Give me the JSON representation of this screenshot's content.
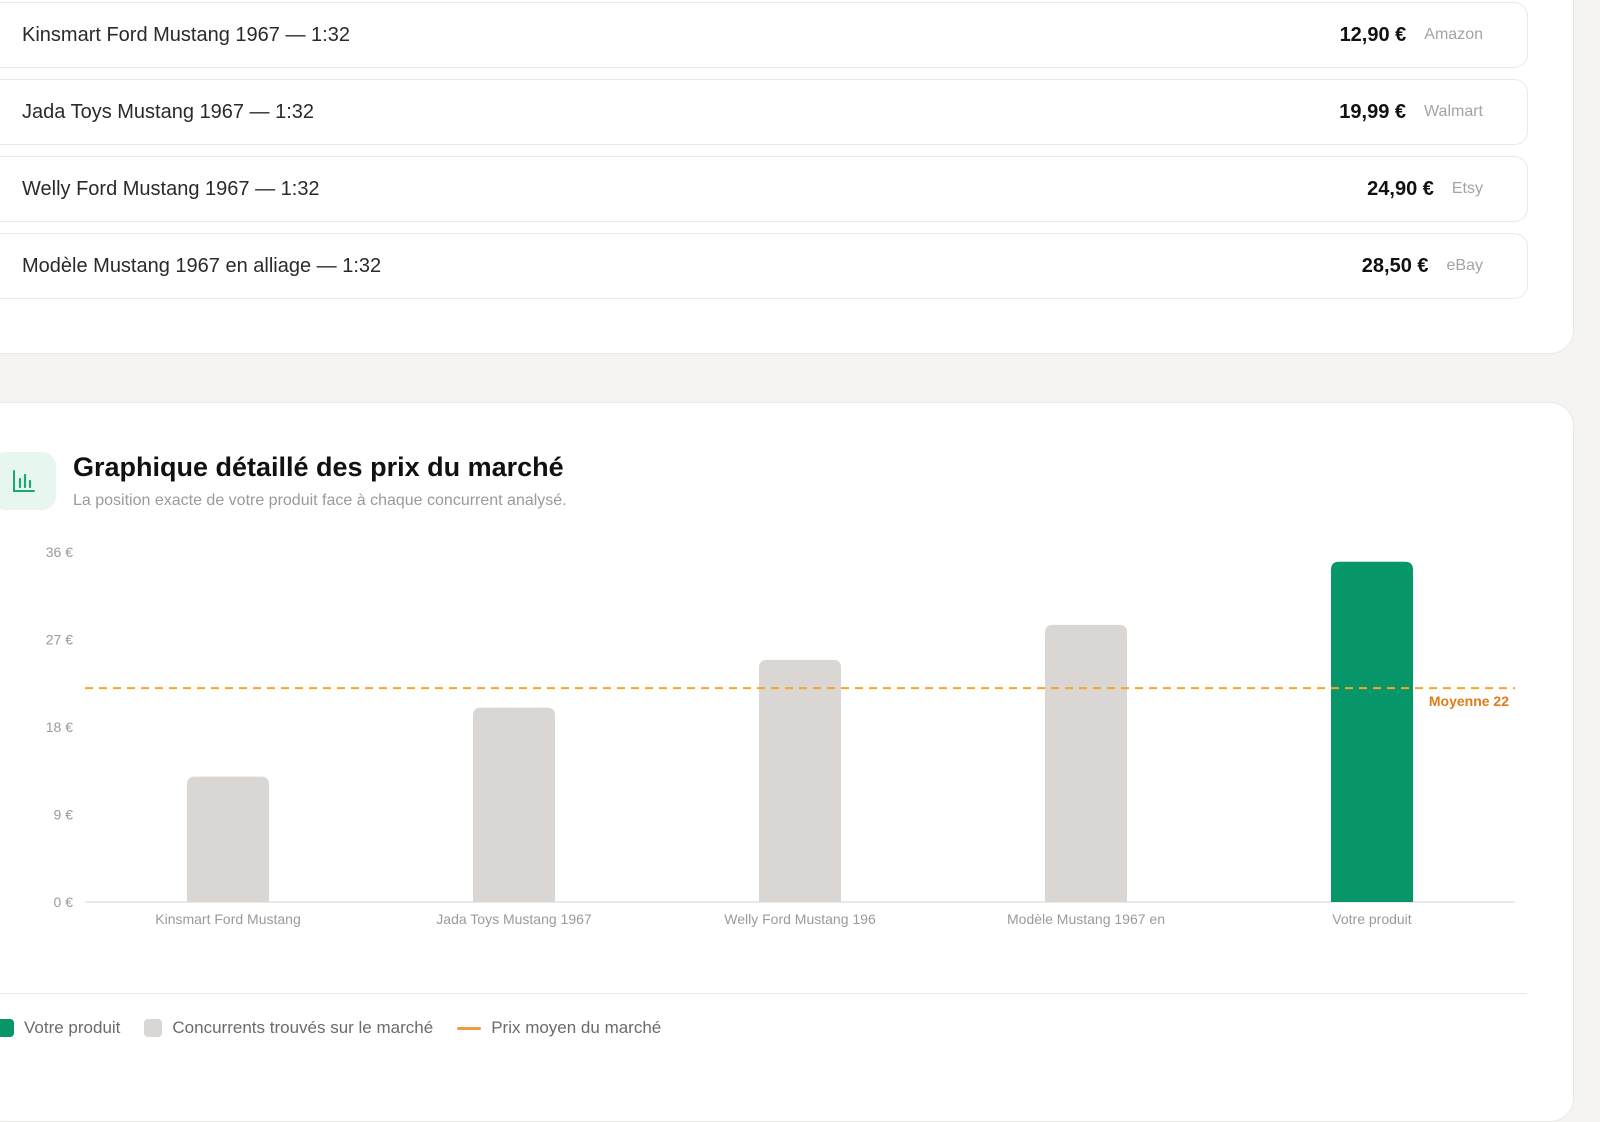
{
  "offers": [
    {
      "name": "Kinsmart Ford Mustang 1967 — 1:32",
      "price": "12,90 €",
      "vendor": "Amazon"
    },
    {
      "name": "Jada Toys Mustang 1967 — 1:32",
      "price": "19,99 €",
      "vendor": "Walmart"
    },
    {
      "name": "Welly Ford Mustang 1967 — 1:32",
      "price": "24,90 €",
      "vendor": "Etsy"
    },
    {
      "name": "Modèle Mustang 1967 en alliage — 1:32",
      "price": "28,50 €",
      "vendor": "eBay"
    }
  ],
  "chart_section": {
    "icon": "bar-chart-icon",
    "title": "Graphique détaillé des prix du marché",
    "subtitle": "La position exacte de votre produit face à chaque concurrent analysé."
  },
  "chart_data": {
    "type": "bar",
    "categories": [
      "Kinsmart Ford Mustang",
      "Jada Toys Mustang 1967",
      "Welly Ford Mustang 196",
      "Modèle Mustang 1967 en",
      "Votre produit"
    ],
    "values": [
      12.9,
      19.99,
      24.9,
      28.5,
      35
    ],
    "highlight_index": 4,
    "y_ticks": [
      "0 €",
      "9 €",
      "18 €",
      "27 €",
      "36 €"
    ],
    "y_tick_values": [
      0,
      9,
      18,
      27,
      36
    ],
    "ylim": [
      0,
      36
    ],
    "average": 22,
    "average_label": "Moyenne 22",
    "colors": {
      "product": "#07956a",
      "competitor": "#d9d6d3",
      "average": "#f5a623",
      "average_text": "#e07b1a"
    }
  },
  "legend": {
    "product": "Votre produit",
    "competitors": "Concurrents trouvés sur le marché",
    "average": "Prix moyen du marché"
  }
}
